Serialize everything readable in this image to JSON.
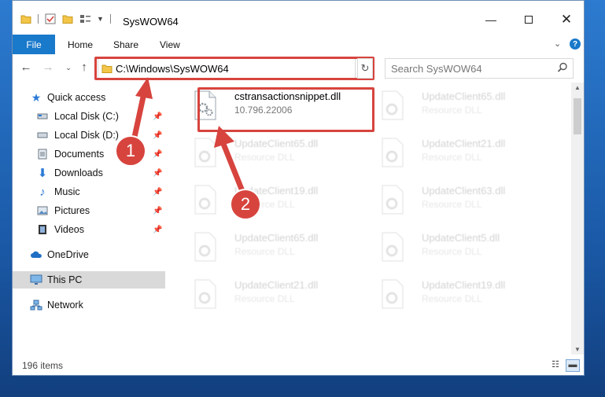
{
  "window": {
    "title": "SysWOW64"
  },
  "ribbon": {
    "file_label": "File",
    "tabs": [
      {
        "label": "Home"
      },
      {
        "label": "Share"
      },
      {
        "label": "View"
      }
    ]
  },
  "navigation": {
    "address": "C:\\Windows\\SysWOW64",
    "search_placeholder": "Search SysWOW64"
  },
  "sidebar": {
    "items": [
      {
        "label": "Quick access",
        "icon": "star-icon"
      },
      {
        "label": "Local Disk (C:)",
        "icon": "drive-icon"
      },
      {
        "label": "Local Disk (D:)",
        "icon": "drive-icon"
      },
      {
        "label": "Documents",
        "icon": "documents-icon"
      },
      {
        "label": "Downloads",
        "icon": "download-arrow-icon"
      },
      {
        "label": "Music",
        "icon": "music-note-icon"
      },
      {
        "label": "Pictures",
        "icon": "pictures-icon"
      },
      {
        "label": "Videos",
        "icon": "film-icon"
      },
      {
        "label": "OneDrive",
        "icon": "cloud-icon"
      },
      {
        "label": "This PC",
        "icon": "monitor-icon"
      },
      {
        "label": "Network",
        "icon": "network-icon"
      }
    ]
  },
  "files": [
    {
      "name": "cstransactionsnippet.dll",
      "sub": "10.796.22006"
    },
    {
      "name": "UpdateClient65.dll",
      "sub": "Resource DLL"
    },
    {
      "name": "UpdateClient65.dll",
      "sub": "Resource DLL"
    },
    {
      "name": "UpdateClient21.dll",
      "sub": "Resource DLL"
    },
    {
      "name": "UpdateClient19.dll",
      "sub": "Resource DLL"
    },
    {
      "name": "UpdateClient63.dll",
      "sub": "Resource DLL"
    },
    {
      "name": "UpdateClient65.dll",
      "sub": "Resource DLL"
    },
    {
      "name": "UpdateClient5.dll",
      "sub": "Resource DLL"
    },
    {
      "name": "UpdateClient21.dll",
      "sub": "Resource DLL"
    },
    {
      "name": "UpdateClient19.dll",
      "sub": "Resource DLL"
    }
  ],
  "status": {
    "item_count": "196 items"
  },
  "annotations": {
    "step1": "1",
    "step2": "2",
    "color": "#d7443e"
  }
}
